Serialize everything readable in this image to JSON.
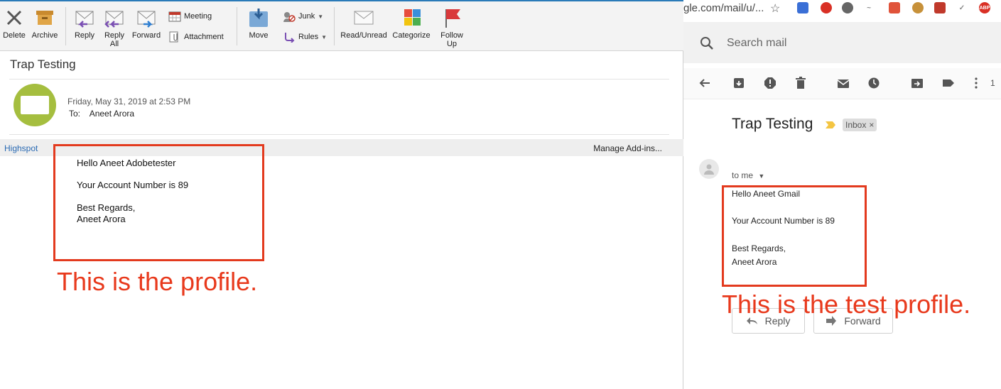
{
  "outlook": {
    "ribbon": {
      "delete": "Delete",
      "archive": "Archive",
      "reply": "Reply",
      "reply_all_1": "Reply",
      "reply_all_2": "All",
      "forward": "Forward",
      "meeting": "Meeting",
      "attachment": "Attachment",
      "move": "Move",
      "junk": "Junk",
      "rules": "Rules",
      "read_unread": "Read/Unread",
      "categorize": "Categorize",
      "follow_up_1": "Follow",
      "follow_up_2": "Up"
    },
    "subject": "Trap Testing",
    "date": "Friday, May 31, 2019 at 2:53 PM",
    "to_label": "To:",
    "to_name": "Aneet Arora",
    "addin_left": "Highspot",
    "addin_right": "Manage Add-ins...",
    "body": [
      "Hello Aneet Adobetester",
      "Your Account Number is 89",
      "Best Regards,",
      "Aneet Arora"
    ],
    "annotation": "This is the profile.",
    "colors": {
      "accent": "#2a7ab8",
      "avatar": "#a5be3f",
      "annotation": "#e8391c"
    }
  },
  "gmail": {
    "url_fragment": "gle.com/mail/u/...",
    "search_placeholder": "Search mail",
    "subject": "Trap Testing",
    "label_chip": "Inbox",
    "label_close": "×",
    "to_me": "to me",
    "body": [
      "Hello Aneet Gmail",
      "Your Account Number is 89",
      "Best Regards,",
      "Aneet Arora"
    ],
    "annotation": "This is the test profile.",
    "reply": "Reply",
    "forward": "Forward",
    "toolbar_more": "1",
    "ext_abp": "ABP"
  }
}
